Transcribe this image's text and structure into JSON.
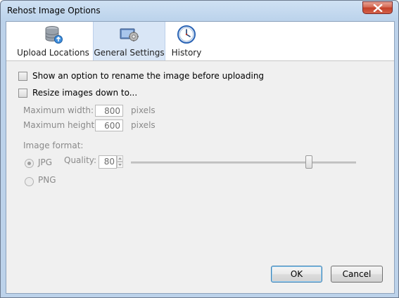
{
  "window": {
    "title": "Rehost Image Options"
  },
  "tabs": [
    {
      "label": "Upload Locations",
      "icon": "database-upload-icon"
    },
    {
      "label": "General Settings",
      "icon": "settings-icon",
      "active": true
    },
    {
      "label": "History",
      "icon": "clock-icon"
    }
  ],
  "options": {
    "rename_label": "Show an option to rename the image before uploading",
    "rename_checked": false,
    "resize_label": "Resize images down to...",
    "resize_checked": false,
    "max_width_label": "Maximum width:",
    "max_width_value": "800",
    "max_height_label": "Maximum height:",
    "max_height_value": "600",
    "unit_label": "pixels"
  },
  "format": {
    "label": "Image format:",
    "jpg_label": "JPG",
    "png_label": "PNG",
    "selected": "JPG",
    "quality_label": "Quality:",
    "quality_value": "80"
  },
  "buttons": {
    "ok": "OK",
    "cancel": "Cancel"
  },
  "colors": {
    "title_bar": "#bdd4ec",
    "close_button": "#c34028",
    "active_tab": "#d9e6f6",
    "default_button_border": "#3c7fb1"
  }
}
